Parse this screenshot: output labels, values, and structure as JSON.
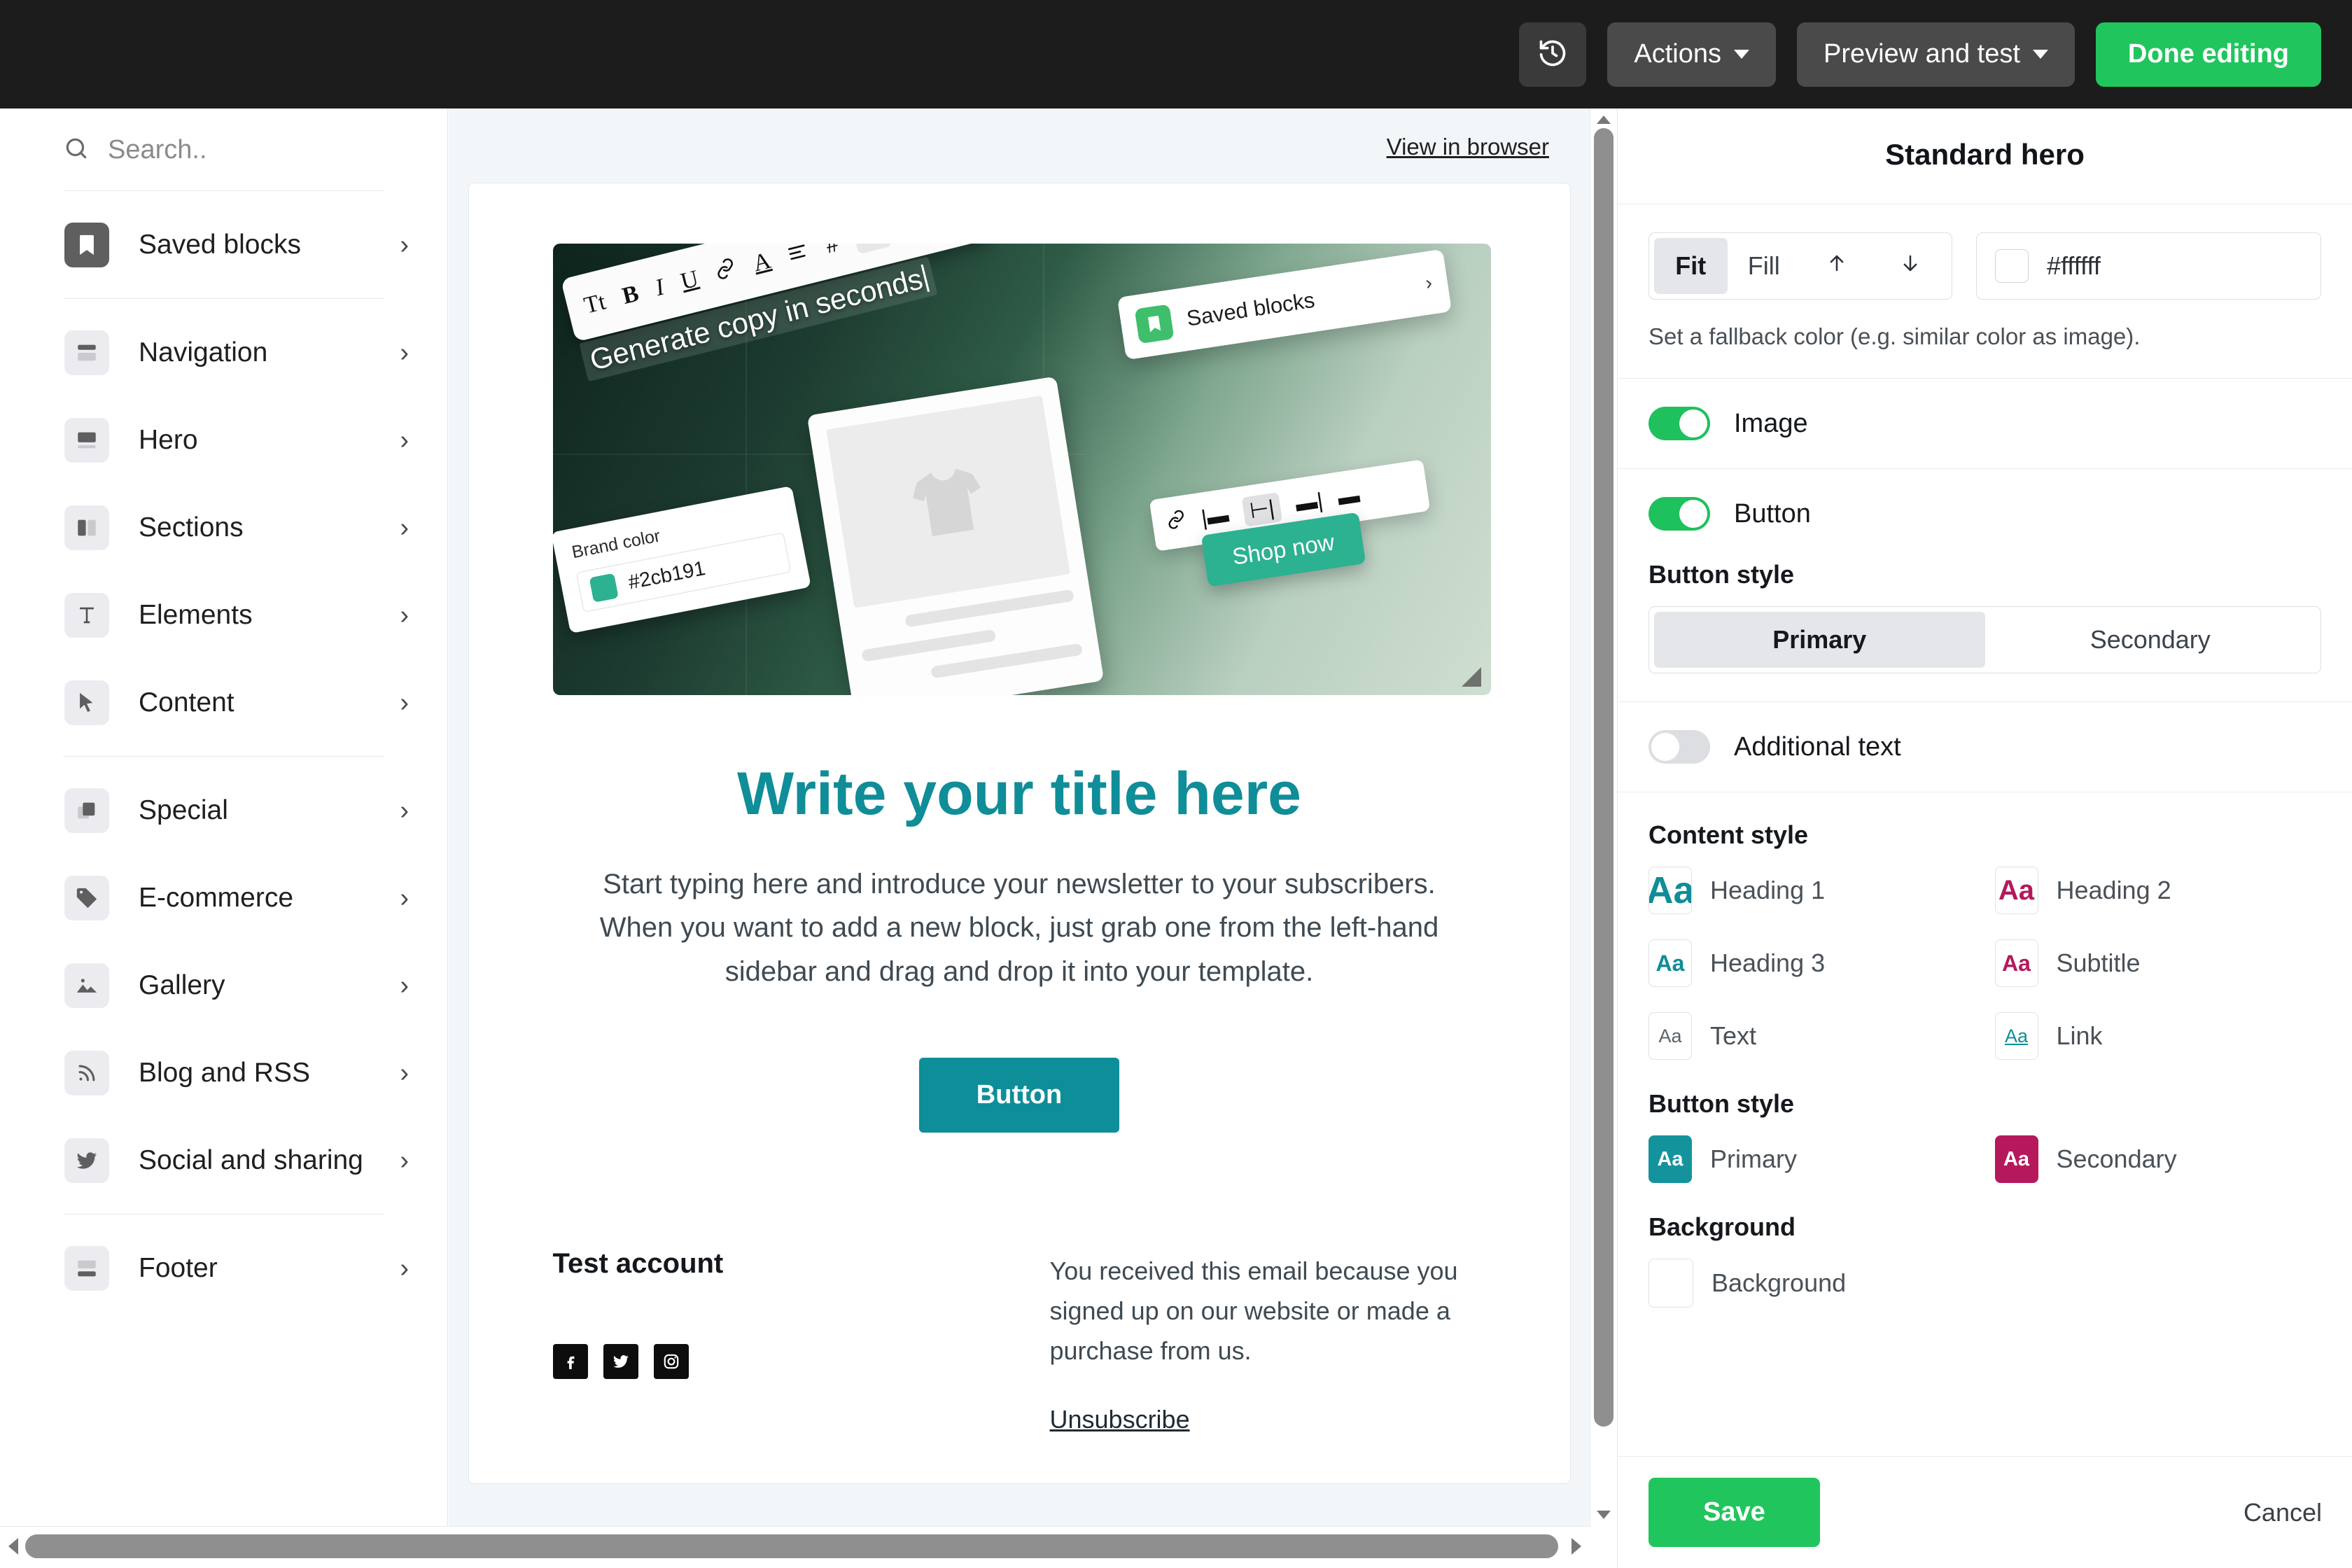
{
  "topbar": {
    "history_icon": "history-clock-icon",
    "actions_label": "Actions",
    "preview_label": "Preview and test",
    "done_label": "Done editing",
    "green": "#21c55d"
  },
  "sidebar": {
    "search_placeholder": "Search..",
    "search_value": "",
    "groups": [
      {
        "items": [
          {
            "label": "Saved blocks",
            "icon": "bookmark-icon"
          }
        ]
      },
      {
        "items": [
          {
            "label": "Navigation",
            "icon": "navigation-block-icon"
          },
          {
            "label": "Hero",
            "icon": "hero-block-icon"
          },
          {
            "label": "Sections",
            "icon": "columns-icon"
          },
          {
            "label": "Elements",
            "icon": "text-t-icon"
          },
          {
            "label": "Content",
            "icon": "cursor-arrow-icon"
          }
        ]
      },
      {
        "items": [
          {
            "label": "Special",
            "icon": "layers-icon"
          },
          {
            "label": "E-commerce",
            "icon": "price-tag-icon"
          },
          {
            "label": "Gallery",
            "icon": "image-mountain-icon"
          },
          {
            "label": "Blog and RSS",
            "icon": "rss-icon"
          },
          {
            "label": "Social and sharing",
            "icon": "twitter-bird-icon"
          }
        ]
      },
      {
        "items": [
          {
            "label": "Footer",
            "icon": "footer-block-icon"
          }
        ]
      }
    ]
  },
  "canvas": {
    "view_in_browser": "View in browser",
    "hero_image": {
      "format_toolbar": [
        "Tt",
        "B",
        "I",
        "U",
        "link-icon",
        "A",
        "align-icon",
        "#",
        "sparkle-icon"
      ],
      "caption": "Generate copy in seconds",
      "brand_card": {
        "label": "Brand color",
        "hex": "#2cb191"
      },
      "saved_blocks_card": {
        "label": "Saved blocks",
        "icon": "bookmark-icon",
        "chevron": "›"
      },
      "align_toolbar": [
        "link-icon",
        "align-left-icon",
        "align-center-icon",
        "align-right-icon",
        "minus-icon"
      ],
      "shop_button": "Shop now",
      "product_placeholder": "tshirt-icon",
      "resize_handle": "resize-corner-handle"
    },
    "email": {
      "title": "Write your title here",
      "paragraph": "Start typing here and introduce your newsletter to your subscribers. When you want to add a new block, just grab one from the left-hand sidebar and drag and drop it into your template.",
      "cta_label": "Button",
      "footer": {
        "account_name": "Test account",
        "social_icons": [
          "facebook-icon",
          "twitter-icon",
          "instagram-icon"
        ],
        "note": "You received this email because you signed up on our website or made a purchase from us.",
        "unsubscribe": "Unsubscribe"
      }
    }
  },
  "panel": {
    "title": "Standard hero",
    "image_fit": {
      "options": [
        "Fit",
        "Fill"
      ],
      "selected": "Fit",
      "move_up_icon": "arrow-up-icon",
      "move_down_icon": "arrow-down-icon"
    },
    "fallback_color": {
      "hex": "#ffffff",
      "swatch": "#ffffff"
    },
    "fallback_hint": "Set a fallback color (e.g. similar color as image).",
    "toggles": [
      {
        "label": "Image",
        "on": true
      },
      {
        "label": "Button",
        "on": true
      },
      {
        "label": "Additional text",
        "on": false
      }
    ],
    "button_style_label": "Button style",
    "button_style": {
      "options": [
        "Primary",
        "Secondary"
      ],
      "selected": "Primary"
    },
    "content_style_label": "Content style",
    "content_styles": [
      {
        "label": "Heading 1",
        "sample": "Aa",
        "color": "#0f8d98"
      },
      {
        "label": "Heading 2",
        "sample": "Aa",
        "color": "#b5195c"
      },
      {
        "label": "Heading 3",
        "sample": "Aa",
        "color": "#0f8d98"
      },
      {
        "label": "Subtitle",
        "sample": "Aa",
        "color": "#b5195c"
      },
      {
        "label": "Text",
        "sample": "Aa",
        "color": "#5a6169"
      },
      {
        "label": "Link",
        "sample": "Aa",
        "color": "#0f8d98"
      }
    ],
    "button_style_swatch_label": "Button style",
    "button_swatches": [
      {
        "label": "Primary",
        "sample": "Aa",
        "color": "#15939d"
      },
      {
        "label": "Secondary",
        "sample": "Aa",
        "color": "#b5195c"
      }
    ],
    "background_label": "Background",
    "background_swatch_label": "Background",
    "save_label": "Save",
    "cancel_label": "Cancel"
  }
}
